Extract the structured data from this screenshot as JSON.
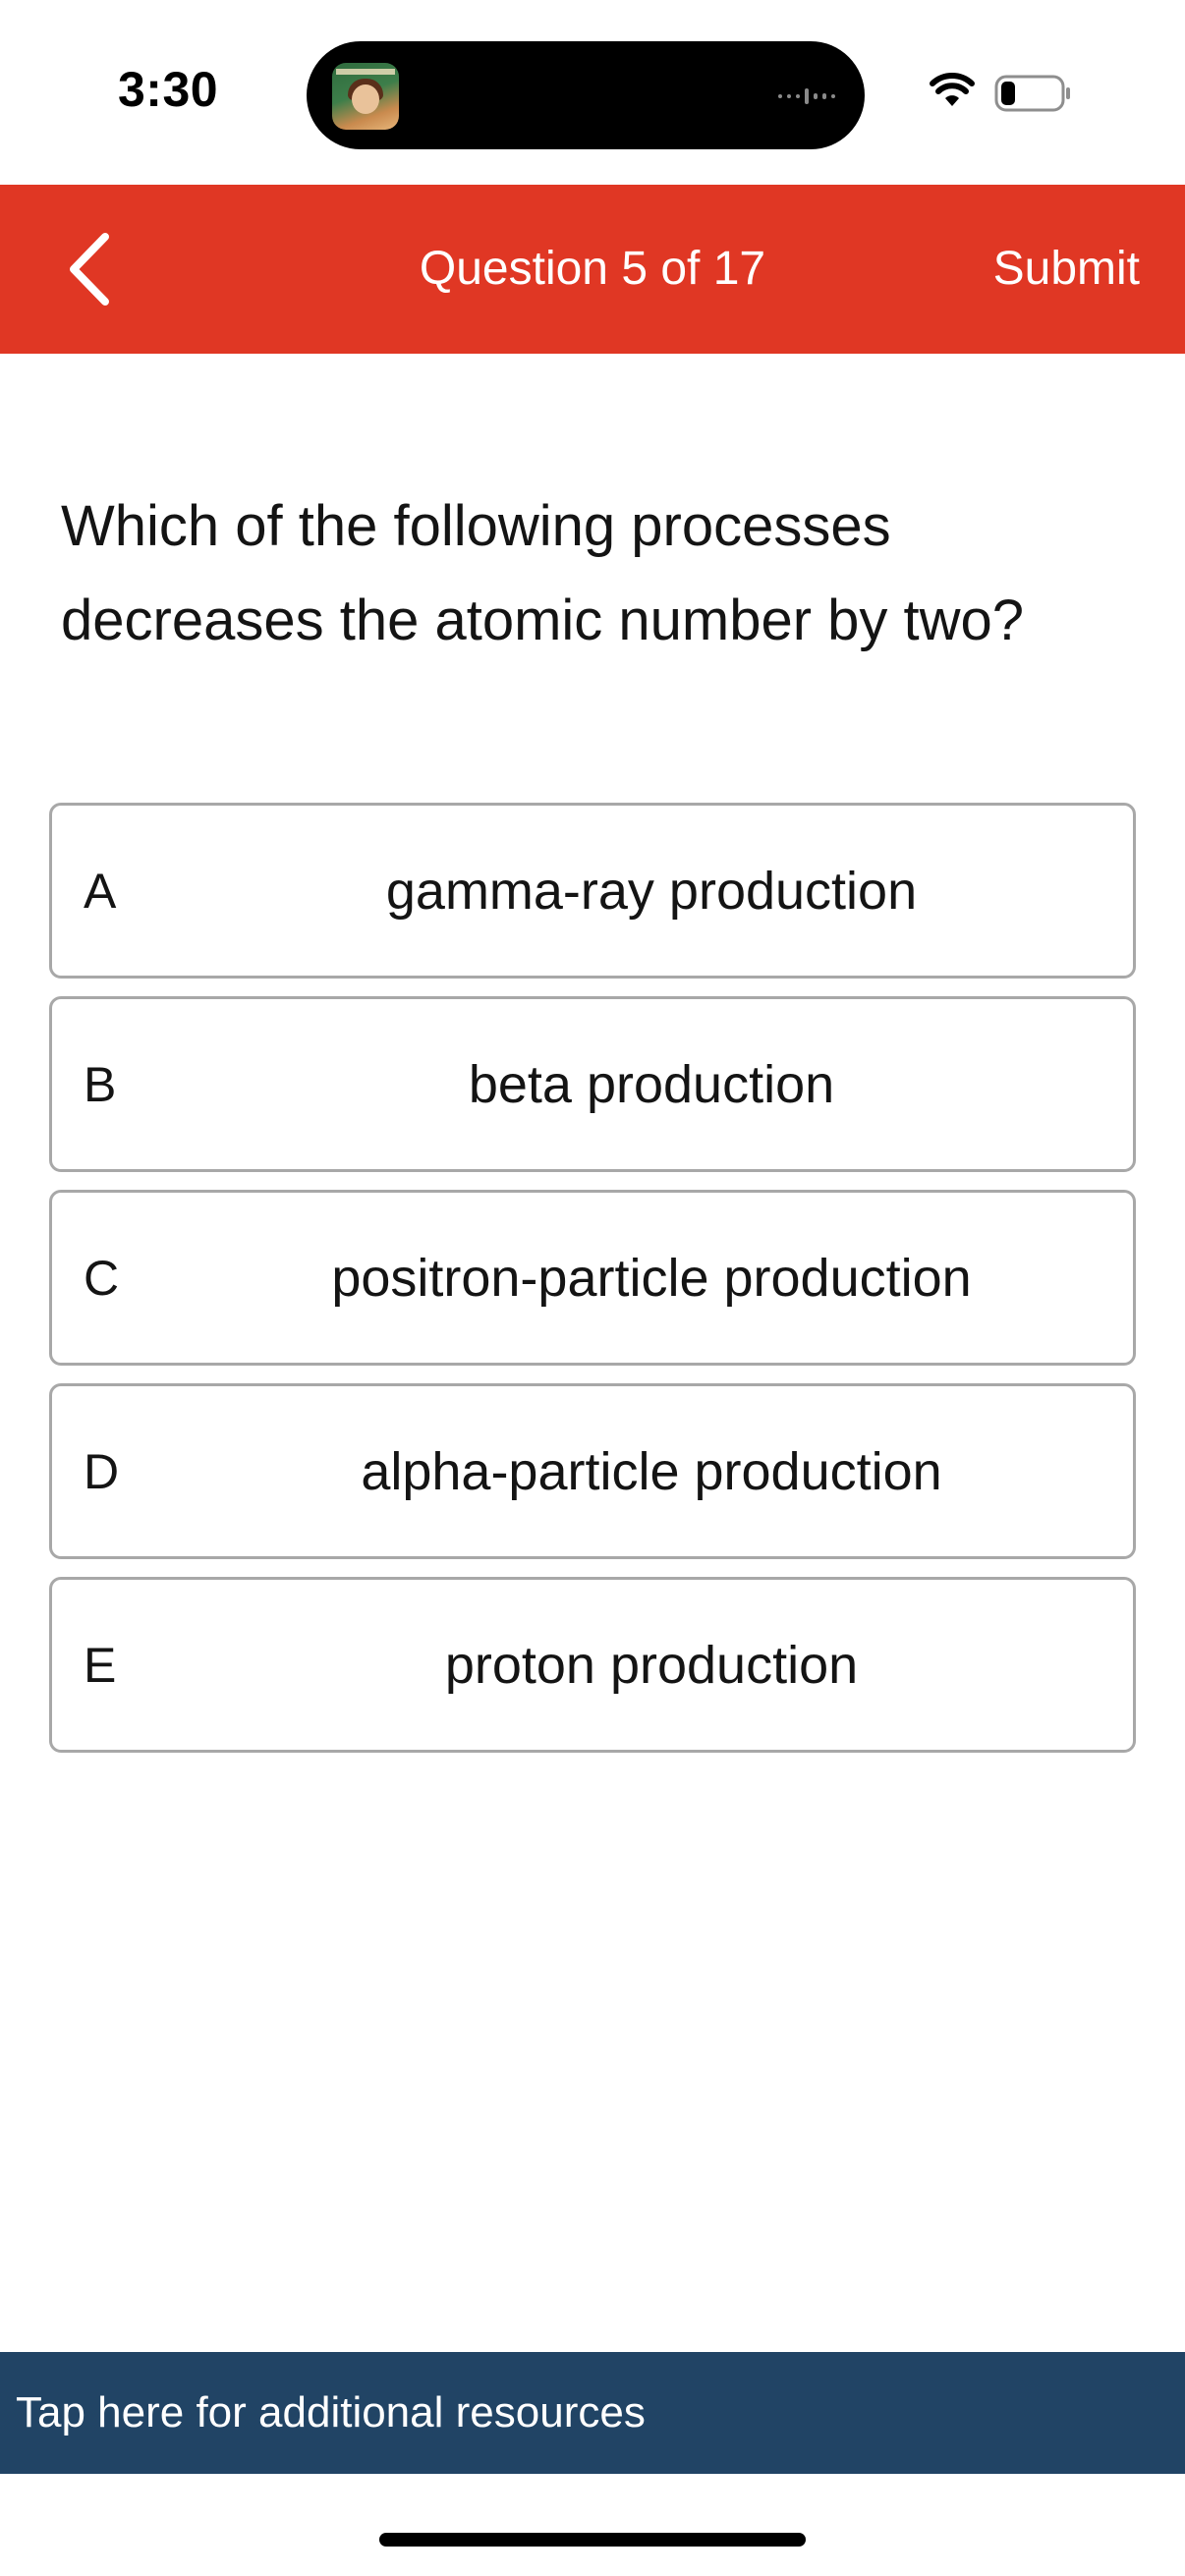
{
  "status_bar": {
    "time": "3:30",
    "icons": [
      "wifi-icon",
      "battery-icon"
    ]
  },
  "nav": {
    "title": "Question 5 of 17",
    "submit_label": "Submit",
    "back_icon": "chevron-left-icon",
    "background_color": "#e03724"
  },
  "question": {
    "text": "Which of the following processes decreases the atomic number by two?"
  },
  "answers": [
    {
      "letter": "A",
      "text": "gamma-ray production"
    },
    {
      "letter": "B",
      "text": "beta production"
    },
    {
      "letter": "C",
      "text": "positron-particle production"
    },
    {
      "letter": "D",
      "text": "alpha-particle production"
    },
    {
      "letter": "E",
      "text": "proton production"
    }
  ],
  "resources": {
    "label": "Tap here for additional resources",
    "background_color": "#214465"
  }
}
